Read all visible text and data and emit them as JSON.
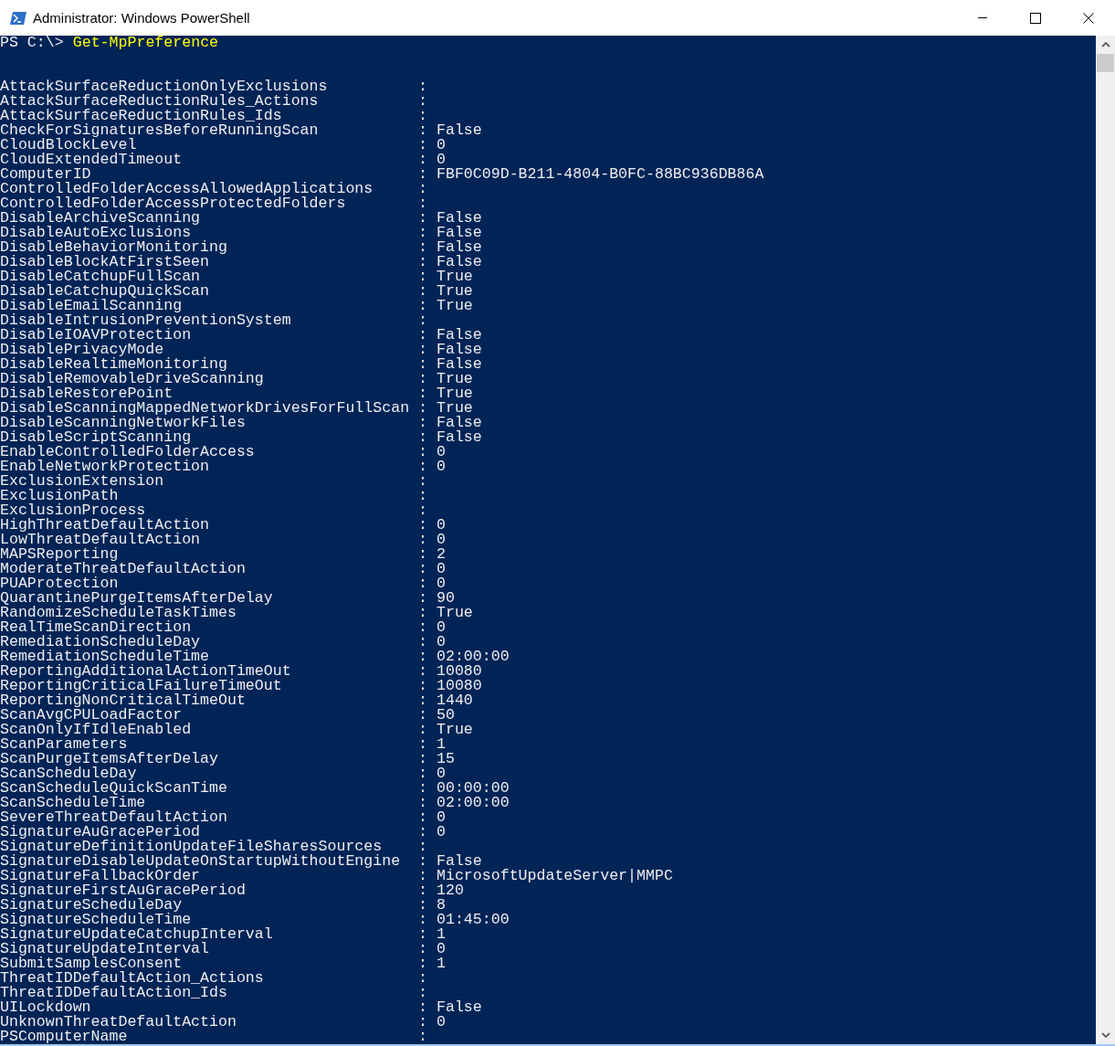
{
  "window": {
    "title": "Administrator: Windows PowerShell"
  },
  "prompt": {
    "path": "PS C:\\>",
    "command": "Get-MpPreference"
  },
  "properties": [
    {
      "name": "AttackSurfaceReductionOnlyExclusions",
      "value": ":"
    },
    {
      "name": "AttackSurfaceReductionRules_Actions",
      "value": ":"
    },
    {
      "name": "AttackSurfaceReductionRules_Ids",
      "value": ":"
    },
    {
      "name": "CheckForSignaturesBeforeRunningScan",
      "value": ": False"
    },
    {
      "name": "CloudBlockLevel",
      "value": ": 0"
    },
    {
      "name": "CloudExtendedTimeout",
      "value": ": 0"
    },
    {
      "name": "ComputerID",
      "value": ": FBF0C09D-B211-4804-B0FC-88BC936DB86A"
    },
    {
      "name": "ControlledFolderAccessAllowedApplications",
      "value": ":"
    },
    {
      "name": "ControlledFolderAccessProtectedFolders",
      "value": ":"
    },
    {
      "name": "DisableArchiveScanning",
      "value": ": False"
    },
    {
      "name": "DisableAutoExclusions",
      "value": ": False"
    },
    {
      "name": "DisableBehaviorMonitoring",
      "value": ": False"
    },
    {
      "name": "DisableBlockAtFirstSeen",
      "value": ": False"
    },
    {
      "name": "DisableCatchupFullScan",
      "value": ": True"
    },
    {
      "name": "DisableCatchupQuickScan",
      "value": ": True"
    },
    {
      "name": "DisableEmailScanning",
      "value": ": True"
    },
    {
      "name": "DisableIntrusionPreventionSystem",
      "value": ":"
    },
    {
      "name": "DisableIOAVProtection",
      "value": ": False"
    },
    {
      "name": "DisablePrivacyMode",
      "value": ": False"
    },
    {
      "name": "DisableRealtimeMonitoring",
      "value": ": False"
    },
    {
      "name": "DisableRemovableDriveScanning",
      "value": ": True"
    },
    {
      "name": "DisableRestorePoint",
      "value": ": True"
    },
    {
      "name": "DisableScanningMappedNetworkDrivesForFullScan",
      "value": ": True"
    },
    {
      "name": "DisableScanningNetworkFiles",
      "value": ": False"
    },
    {
      "name": "DisableScriptScanning",
      "value": ": False"
    },
    {
      "name": "EnableControlledFolderAccess",
      "value": ": 0"
    },
    {
      "name": "EnableNetworkProtection",
      "value": ": 0"
    },
    {
      "name": "ExclusionExtension",
      "value": ":"
    },
    {
      "name": "ExclusionPath",
      "value": ":"
    },
    {
      "name": "ExclusionProcess",
      "value": ":"
    },
    {
      "name": "HighThreatDefaultAction",
      "value": ": 0"
    },
    {
      "name": "LowThreatDefaultAction",
      "value": ": 0"
    },
    {
      "name": "MAPSReporting",
      "value": ": 2"
    },
    {
      "name": "ModerateThreatDefaultAction",
      "value": ": 0"
    },
    {
      "name": "PUAProtection",
      "value": ": 0"
    },
    {
      "name": "QuarantinePurgeItemsAfterDelay",
      "value": ": 90"
    },
    {
      "name": "RandomizeScheduleTaskTimes",
      "value": ": True"
    },
    {
      "name": "RealTimeScanDirection",
      "value": ": 0"
    },
    {
      "name": "RemediationScheduleDay",
      "value": ": 0"
    },
    {
      "name": "RemediationScheduleTime",
      "value": ": 02:00:00"
    },
    {
      "name": "ReportingAdditionalActionTimeOut",
      "value": ": 10080"
    },
    {
      "name": "ReportingCriticalFailureTimeOut",
      "value": ": 10080"
    },
    {
      "name": "ReportingNonCriticalTimeOut",
      "value": ": 1440"
    },
    {
      "name": "ScanAvgCPULoadFactor",
      "value": ": 50"
    },
    {
      "name": "ScanOnlyIfIdleEnabled",
      "value": ": True"
    },
    {
      "name": "ScanParameters",
      "value": ": 1"
    },
    {
      "name": "ScanPurgeItemsAfterDelay",
      "value": ": 15"
    },
    {
      "name": "ScanScheduleDay",
      "value": ": 0"
    },
    {
      "name": "ScanScheduleQuickScanTime",
      "value": ": 00:00:00"
    },
    {
      "name": "ScanScheduleTime",
      "value": ": 02:00:00"
    },
    {
      "name": "SevereThreatDefaultAction",
      "value": ": 0"
    },
    {
      "name": "SignatureAuGracePeriod",
      "value": ": 0"
    },
    {
      "name": "SignatureDefinitionUpdateFileSharesSources",
      "value": ":"
    },
    {
      "name": "SignatureDisableUpdateOnStartupWithoutEngine",
      "value": ": False"
    },
    {
      "name": "SignatureFallbackOrder",
      "value": ": MicrosoftUpdateServer|MMPC"
    },
    {
      "name": "SignatureFirstAuGracePeriod",
      "value": ": 120"
    },
    {
      "name": "SignatureScheduleDay",
      "value": ": 8"
    },
    {
      "name": "SignatureScheduleTime",
      "value": ": 01:45:00"
    },
    {
      "name": "SignatureUpdateCatchupInterval",
      "value": ": 1"
    },
    {
      "name": "SignatureUpdateInterval",
      "value": ": 0"
    },
    {
      "name": "SubmitSamplesConsent",
      "value": ": 1"
    },
    {
      "name": "ThreatIDDefaultAction_Actions",
      "value": ":"
    },
    {
      "name": "ThreatIDDefaultAction_Ids",
      "value": ":"
    },
    {
      "name": "UILockdown",
      "value": ": False"
    },
    {
      "name": "UnknownThreatDefaultAction",
      "value": ": 0"
    },
    {
      "name": "PSComputerName",
      "value": ":"
    }
  ]
}
